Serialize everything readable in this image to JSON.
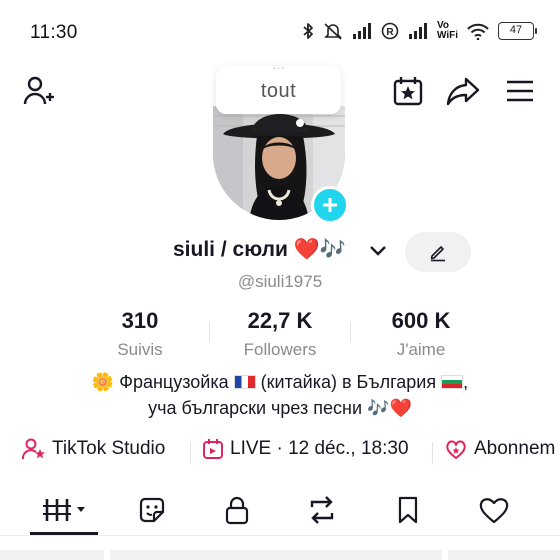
{
  "status_bar": {
    "time": "11:30",
    "vowifi": "Vo\nWiFi",
    "battery": "47",
    "icons": [
      "bluetooth-icon",
      "mute-icon",
      "signal-icon",
      "registered-icon",
      "signal-icon",
      "wifi-icon",
      "battery-icon"
    ]
  },
  "top_nav": {
    "icons": [
      "add-friend-icon",
      "creator-calendar-icon",
      "share-icon",
      "menu-icon"
    ]
  },
  "note": {
    "ghost_text": "...",
    "text": "tout"
  },
  "profile": {
    "name": "siuli / сюли",
    "name_emojis": "❤️🎶",
    "username": "@siuli1975"
  },
  "stats": [
    {
      "value": "310",
      "label": "Suivis"
    },
    {
      "value": "22,7 K",
      "label": "Followers"
    },
    {
      "value": "600 K",
      "label": "J'aime"
    }
  ],
  "bio": {
    "line1_prefix": "🌼",
    "line1_a": "Французойка",
    "line1_b": "(китайка) в България",
    "line1_c": ",",
    "line2_text": "уча български чрез песни",
    "line2_notes": "🎶",
    "line2_heart": "❤️"
  },
  "links": [
    {
      "label": "TikTok Studio",
      "icon": "tiktok-studio-icon"
    },
    {
      "label": "LIVE · 12 déc., 18:30",
      "icon": "live-calendar-icon"
    },
    {
      "label": "Abonnem",
      "icon": "subscription-icon"
    }
  ],
  "tabs": [
    {
      "name": "videos",
      "icon": "grid-icon",
      "active": true
    },
    {
      "name": "reposts-stickers",
      "icon": "sticker-icon"
    },
    {
      "name": "private",
      "icon": "lock-icon"
    },
    {
      "name": "reposts",
      "icon": "repost-icon"
    },
    {
      "name": "favorites",
      "icon": "bookmark-icon"
    },
    {
      "name": "liked",
      "icon": "heart-icon"
    }
  ],
  "colors": {
    "accent_cyan": "#20d5ec",
    "live_pink": "#e0245e",
    "text_primary": "#161823",
    "text_secondary": "#8a8b91"
  }
}
